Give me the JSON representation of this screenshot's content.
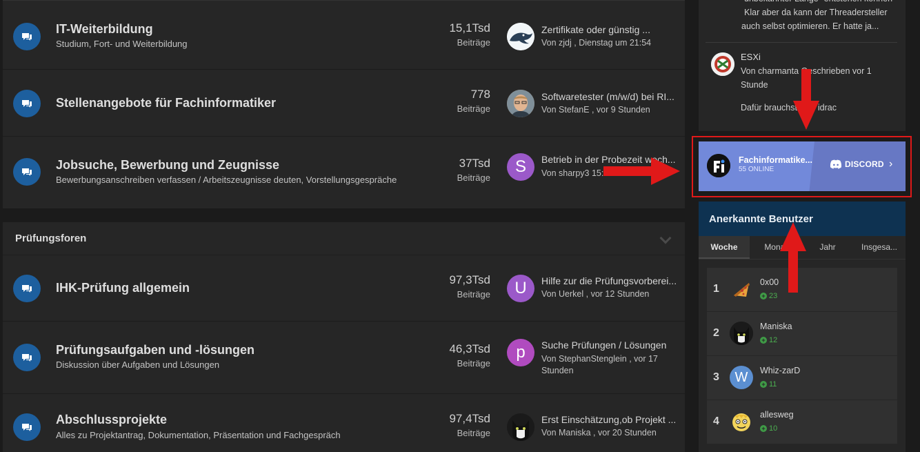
{
  "categories": {
    "a": {
      "forums": [
        {
          "title": "IT-Weiterbildung",
          "description": "Studium, Fort- und Weiterbildung",
          "count": "15,1Tsd",
          "count_label": "Beiträge",
          "last_title": "Zertifikate oder günstig ...",
          "last_meta": "Von zjdj , Dienstag um 21:54"
        },
        {
          "title": "Stellenangebote für Fachinformatiker",
          "description": "",
          "count": "778",
          "count_label": "Beiträge",
          "last_title": "Softwaretester (m/w/d) bei RI...",
          "last_meta": "Von StefanE , vor 9 Stunden"
        },
        {
          "title": "Jobsuche, Bewerbung und Zeugnisse",
          "description": "Bewerbungsanschreiben verfassen / Arbeitszeugnisse deuten, Vorstellungsgespräche",
          "count": "37Tsd",
          "count_label": "Beiträge",
          "last_title": "Betrieb in der Probezeit wech...",
          "last_meta": "Von sharpy3 15:38",
          "avatar_letter": "S"
        }
      ]
    },
    "b": {
      "title": "Prüfungsforen",
      "forums": [
        {
          "title": "IHK-Prüfung allgemein",
          "description": "",
          "count": "97,3Tsd",
          "count_label": "Beiträge",
          "last_title": "Hilfe zur die Prüfungsvorberei...",
          "last_meta": "Von Uerkel , vor 12 Stunden",
          "avatar_letter": "U"
        },
        {
          "title": "Prüfungsaufgaben und -lösungen",
          "description": "Diskussion über Aufgaben und Lösungen",
          "count": "46,3Tsd",
          "count_label": "Beiträge",
          "last_title": "Suche Prüfungen / Lösungen",
          "last_meta": "Von StephanStenglein , vor 17 Stunden",
          "avatar_letter": "p"
        },
        {
          "title": "Abschlussprojekte",
          "description": "Alles zu Projektantrag, Dokumentation, Präsentation und Fachgespräch",
          "count": "97,4Tsd",
          "count_label": "Beiträge",
          "last_title": "Erst Einschätzung,ob Projekt ...",
          "last_meta": "Von Maniska , vor 20 Stunden"
        }
      ]
    }
  },
  "sidebar": {
    "top_text_1": "unbekannter Länge\" entstehen können",
    "top_text_2": "Klar aber da kann der Threadersteller",
    "top_text_3": "auch selbst optimieren. Er hatte ja...",
    "esxi_title": "ESXi",
    "esxi_meta": "Von charmanta Geschrieben vor 1 Stunde",
    "esxi_snippet": "Dafür brauchst kein idrac",
    "discord": {
      "name": "Fachinformatike...",
      "online": "55 ONLINE",
      "brand": "DISCORD"
    },
    "users": {
      "title": "Anerkannte Benutzer",
      "tabs": [
        "Woche",
        "Monat",
        "Jahr",
        "Insgesa..."
      ],
      "list": [
        {
          "rank": "1",
          "name": "0x00",
          "points": "23"
        },
        {
          "rank": "2",
          "name": "Maniska",
          "points": "12"
        },
        {
          "rank": "3",
          "name": "Whiz-zarD",
          "points": "11",
          "avatar_letter": "W"
        },
        {
          "rank": "4",
          "name": "allesweg",
          "points": "10"
        }
      ]
    }
  },
  "colors": {
    "forum_icon": "#1d5f9e",
    "discord": "#7289da",
    "header_blue": "#0e3251",
    "arrow_red": "#e01919",
    "avatar_purple": "#9b59c9",
    "positive_green": "#4caf50"
  }
}
